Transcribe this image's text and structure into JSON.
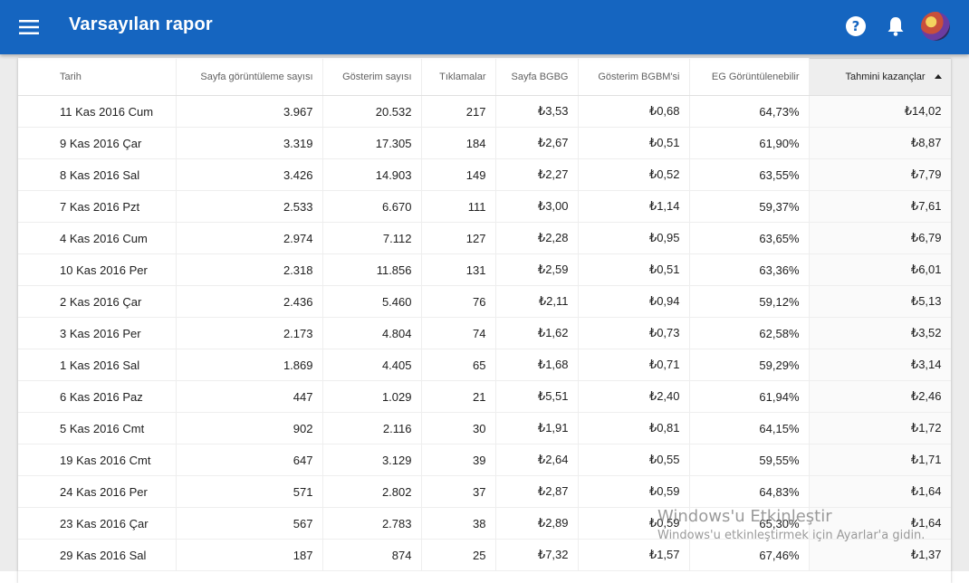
{
  "appbar": {
    "title": "Varsayılan rapor",
    "color": "#1565c0",
    "icons": [
      "menu-icon",
      "help-icon",
      "bell-icon",
      "avatar"
    ]
  },
  "table": {
    "columns": [
      "Tarih",
      "Sayfa görüntüleme sayısı",
      "Gösterim sayısı",
      "Tıklamalar",
      "Sayfa BGBG",
      "Gösterim BGBM'si",
      "EG Görüntülenebilir",
      "Tahmini kazançlar"
    ],
    "sorted_column": "Tahmini kazançlar",
    "sort_direction": "ascending-arrow",
    "rows": [
      [
        "11 Kas 2016 Cum",
        "3.967",
        "20.532",
        "217",
        "₺3,53",
        "₺0,68",
        "64,73%",
        "₺14,02"
      ],
      [
        "9 Kas 2016 Çar",
        "3.319",
        "17.305",
        "184",
        "₺2,67",
        "₺0,51",
        "61,90%",
        "₺8,87"
      ],
      [
        "8 Kas 2016 Sal",
        "3.426",
        "14.903",
        "149",
        "₺2,27",
        "₺0,52",
        "63,55%",
        "₺7,79"
      ],
      [
        "7 Kas 2016 Pzt",
        "2.533",
        "6.670",
        "111",
        "₺3,00",
        "₺1,14",
        "59,37%",
        "₺7,61"
      ],
      [
        "4 Kas 2016 Cum",
        "2.974",
        "7.112",
        "127",
        "₺2,28",
        "₺0,95",
        "63,65%",
        "₺6,79"
      ],
      [
        "10 Kas 2016 Per",
        "2.318",
        "11.856",
        "131",
        "₺2,59",
        "₺0,51",
        "63,36%",
        "₺6,01"
      ],
      [
        "2 Kas 2016 Çar",
        "2.436",
        "5.460",
        "76",
        "₺2,11",
        "₺0,94",
        "59,12%",
        "₺5,13"
      ],
      [
        "3 Kas 2016 Per",
        "2.173",
        "4.804",
        "74",
        "₺1,62",
        "₺0,73",
        "62,58%",
        "₺3,52"
      ],
      [
        "1 Kas 2016 Sal",
        "1.869",
        "4.405",
        "65",
        "₺1,68",
        "₺0,71",
        "59,29%",
        "₺3,14"
      ],
      [
        "6 Kas 2016 Paz",
        "447",
        "1.029",
        "21",
        "₺5,51",
        "₺2,40",
        "61,94%",
        "₺2,46"
      ],
      [
        "5 Kas 2016 Cmt",
        "902",
        "2.116",
        "30",
        "₺1,91",
        "₺0,81",
        "64,15%",
        "₺1,72"
      ],
      [
        "19 Kas 2016 Cmt",
        "647",
        "3.129",
        "39",
        "₺2,64",
        "₺0,55",
        "59,55%",
        "₺1,71"
      ],
      [
        "24 Kas 2016 Per",
        "571",
        "2.802",
        "37",
        "₺2,87",
        "₺0,59",
        "64,83%",
        "₺1,64"
      ],
      [
        "23 Kas 2016 Çar",
        "567",
        "2.783",
        "38",
        "₺2,89",
        "₺0,59",
        "65,30%",
        "₺1,64"
      ],
      [
        "29 Kas 2016 Sal",
        "187",
        "874",
        "25",
        "₺7,32",
        "₺1,57",
        "67,46%",
        "₺1,37"
      ]
    ]
  },
  "watermark": {
    "title": "Windows'u Etkinleştir",
    "subtitle": "Windows'u etkinleştirmek için Ayarlar'a gidin."
  }
}
